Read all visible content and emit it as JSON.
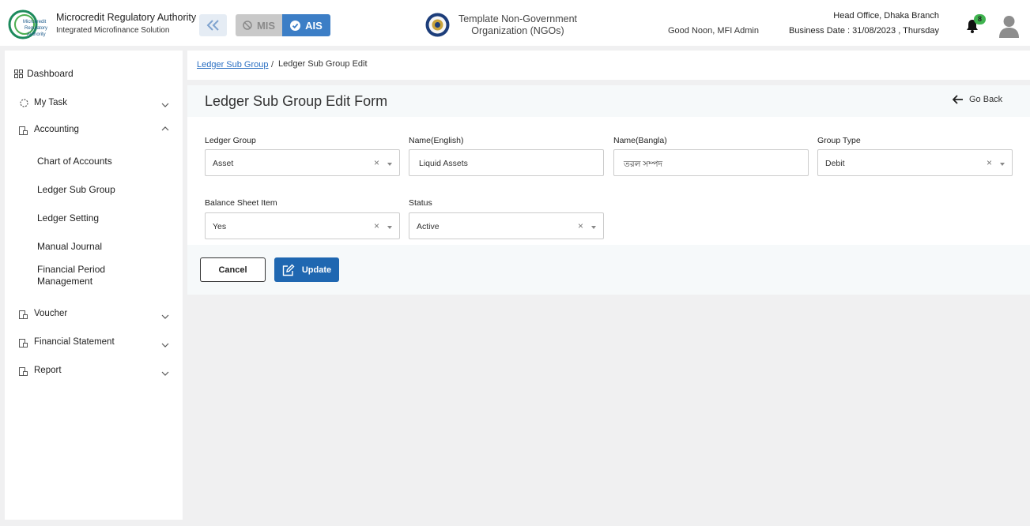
{
  "header": {
    "org_name": "Microcredit Regulatory Authority",
    "org_subtitle": "Integrated Microfinance Solution",
    "logo_text": [
      "Microcredit",
      "Regulatory",
      "Authority"
    ],
    "mis_label": "MIS",
    "ais_label": "AIS",
    "ngo_line1": "Template Non-Government",
    "ngo_line2": "Organization (NGOs)",
    "greeting": "Good Noon, MFI Admin",
    "branch": "Head Office, Dhaka Branch",
    "business_date": "Business Date : 31/08/2023 , Thursday",
    "notification_count": "8"
  },
  "sidebar": {
    "dashboard": "Dashboard",
    "my_task": "My Task",
    "accounting": "Accounting",
    "accounting_items": [
      "Chart of Accounts",
      "Ledger Sub Group",
      "Ledger Setting",
      "Manual Journal",
      "Financial Period Management"
    ],
    "voucher": "Voucher",
    "financial_statement": "Financial Statement",
    "report": "Report"
  },
  "breadcrumb": {
    "parent": "Ledger Sub Group",
    "separator": "/",
    "current": "Ledger Sub Group Edit"
  },
  "form": {
    "title": "Ledger Sub Group Edit Form",
    "go_back": "Go Back",
    "ledger_group": {
      "label": "Ledger Group",
      "value": "Asset"
    },
    "name_english": {
      "label": "Name(English)",
      "value": "Liquid Assets"
    },
    "name_bangla": {
      "label": "Name(Bangla)",
      "value": "তরল সম্পদ"
    },
    "group_type": {
      "label": "Group Type",
      "value": "Debit"
    },
    "balance_sheet_item": {
      "label": "Balance Sheet Item",
      "value": "Yes"
    },
    "status": {
      "label": "Status",
      "value": "Active"
    },
    "clear_symbol": "×",
    "cancel_label": "Cancel",
    "update_label": "Update"
  },
  "colors": {
    "primary": "#1f67b1",
    "ais_accent": "#3c7ec6",
    "badge": "#3fb34f",
    "link": "#2a6fc2"
  }
}
